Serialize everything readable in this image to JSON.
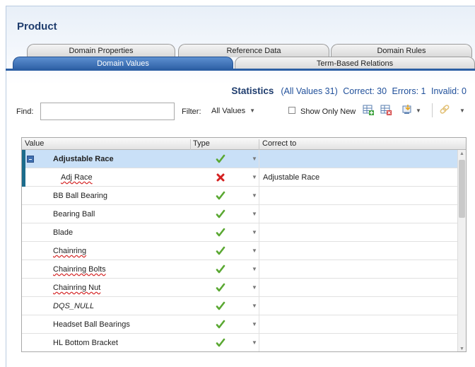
{
  "title": "Product",
  "tabs": {
    "row1": [
      "Domain Properties",
      "Reference Data",
      "Domain Rules"
    ],
    "row2": [
      "Domain Values",
      "Term-Based Relations"
    ],
    "active": "Domain Values"
  },
  "stats": {
    "label": "Statistics",
    "all": "(All Values 31)",
    "correct": "Correct: 30",
    "errors": "Errors: 1",
    "invalid": "Invalid: 0"
  },
  "find": {
    "label": "Find:",
    "value": ""
  },
  "filter": {
    "label": "Filter:",
    "value": "All Values"
  },
  "show_only_new": {
    "label": "Show Only New",
    "checked": false
  },
  "grid": {
    "columns": [
      "Value",
      "Type",
      "Correct to"
    ],
    "rows": [
      {
        "value": "Adjustable Race",
        "type": "correct",
        "correct_to": "",
        "selected": true,
        "group": true
      },
      {
        "value": "Adj Race",
        "type": "error",
        "correct_to": "Adjustable Race",
        "child": true
      },
      {
        "value": "BB Ball Bearing",
        "type": "correct",
        "correct_to": ""
      },
      {
        "value": "Bearing Ball",
        "type": "correct",
        "correct_to": ""
      },
      {
        "value": "Blade",
        "type": "correct",
        "correct_to": ""
      },
      {
        "value": "Chainring",
        "type": "correct",
        "correct_to": "",
        "spell": true
      },
      {
        "value": "Chainring Bolts",
        "type": "correct",
        "correct_to": "",
        "spell": true
      },
      {
        "value": "Chainring Nut",
        "type": "correct",
        "correct_to": "",
        "spell": true
      },
      {
        "value": "DQS_NULL",
        "type": "correct",
        "correct_to": "",
        "italic": true
      },
      {
        "value": "Headset Ball Bearings",
        "type": "correct",
        "correct_to": ""
      },
      {
        "value": "HL Bottom Bracket",
        "type": "correct",
        "correct_to": ""
      }
    ]
  },
  "colors": {
    "accent": "#2c5fa4",
    "title": "#1f3d6e",
    "selected_row": "#c9e0f7",
    "check": "#5aa832",
    "error": "#d42020"
  }
}
